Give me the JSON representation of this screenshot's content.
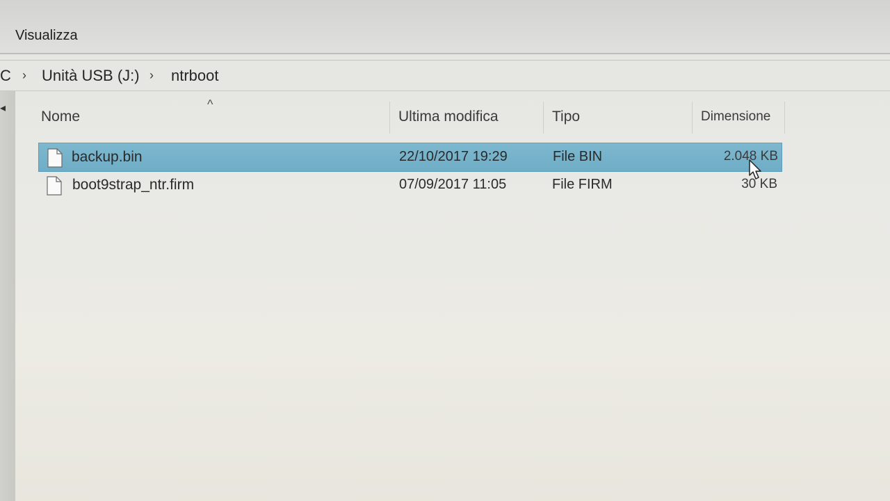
{
  "ribbon": {
    "tab_view": "Visualizza"
  },
  "address": {
    "crumbs": [
      "C",
      "Unità USB (J:)",
      "ntrboot"
    ]
  },
  "columns": {
    "name": "Nome",
    "modified": "Ultima modifica",
    "type": "Tipo",
    "size": "Dimensione",
    "sort_indicator": "^"
  },
  "files": [
    {
      "name": "backup.bin",
      "modified": "22/10/2017 19:29",
      "type": "File BIN",
      "size": "2.048 KB",
      "selected": true
    },
    {
      "name": "boot9strap_ntr.firm",
      "modified": "07/09/2017 11:05",
      "type": "File FIRM",
      "size": "30 KB",
      "selected": false
    }
  ],
  "colors": {
    "selection": "#72afc8",
    "background": "#e9e9e4"
  }
}
